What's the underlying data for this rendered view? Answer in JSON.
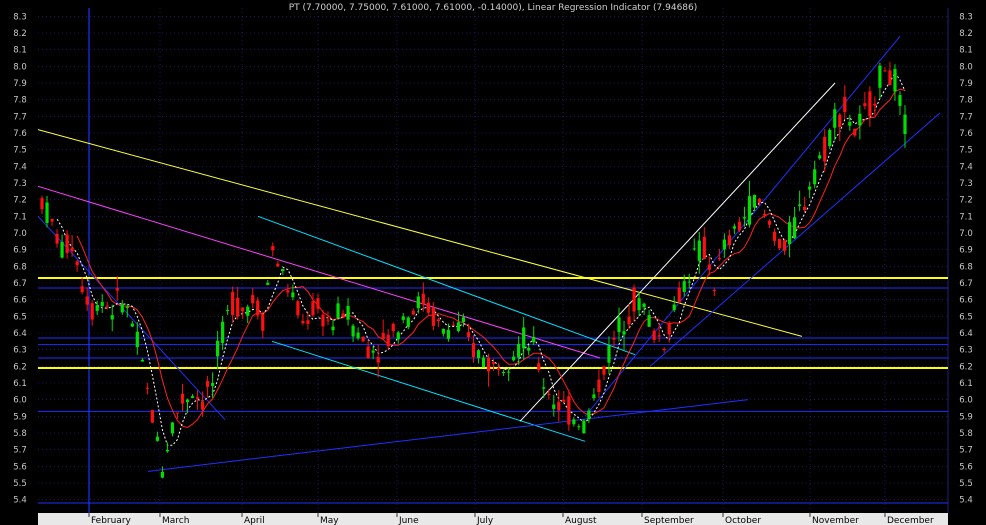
{
  "chart_data": {
    "type": "candlestick",
    "title": "PT (7.70000, 7.75000, 7.61000, 7.61000, -0.14000), Linear Regression Indicator (7.94686)",
    "y_ticks": [
      "5.4",
      "5.5",
      "5.6",
      "5.7",
      "5.8",
      "5.9",
      "6.0",
      "6.1",
      "6.2",
      "6.3",
      "6.4",
      "6.5",
      "6.6",
      "6.7",
      "6.8",
      "6.9",
      "7.0",
      "7.1",
      "7.2",
      "7.3",
      "7.4",
      "7.5",
      "7.6",
      "7.7",
      "7.8",
      "7.9",
      "8.0",
      "8.1",
      "8.2",
      "8.3"
    ],
    "ylim": [
      5.35,
      8.35
    ],
    "x_month_labels": [
      "February",
      "March",
      "April",
      "May",
      "June",
      "July",
      "August",
      "September",
      "October",
      "November",
      "December"
    ],
    "grid": "dotted",
    "series": [
      {
        "name": "PT",
        "type": "candlestick",
        "last": {
          "open": 7.7,
          "high": 7.75,
          "low": 7.61,
          "close": 7.61,
          "change": -0.14
        }
      },
      {
        "name": "Linear Regression Indicator",
        "value": 7.94686
      }
    ],
    "price_path": [
      [
        0,
        7.2
      ],
      [
        2,
        7.05
      ],
      [
        4,
        6.9
      ],
      [
        6,
        6.95
      ],
      [
        8,
        6.7
      ],
      [
        10,
        6.55
      ],
      [
        12,
        6.6
      ],
      [
        14,
        6.55
      ],
      [
        16,
        6.6
      ],
      [
        18,
        6.45
      ],
      [
        20,
        6.2
      ],
      [
        22,
        5.9
      ],
      [
        24,
        5.6
      ],
      [
        26,
        5.85
      ],
      [
        28,
        6.0
      ],
      [
        30,
        6.05
      ],
      [
        32,
        6.0
      ],
      [
        34,
        6.1
      ],
      [
        36,
        6.4
      ],
      [
        38,
        6.6
      ],
      [
        40,
        6.55
      ],
      [
        42,
        6.6
      ],
      [
        44,
        6.5
      ],
      [
        46,
        6.9
      ],
      [
        48,
        6.75
      ],
      [
        50,
        6.6
      ],
      [
        52,
        6.45
      ],
      [
        54,
        6.55
      ],
      [
        56,
        6.5
      ],
      [
        58,
        6.45
      ],
      [
        60,
        6.55
      ],
      [
        62,
        6.45
      ],
      [
        64,
        6.35
      ],
      [
        66,
        6.3
      ],
      [
        68,
        6.35
      ],
      [
        70,
        6.4
      ],
      [
        72,
        6.5
      ],
      [
        74,
        6.55
      ],
      [
        76,
        6.6
      ],
      [
        78,
        6.5
      ],
      [
        80,
        6.4
      ],
      [
        82,
        6.45
      ],
      [
        84,
        6.4
      ],
      [
        86,
        6.3
      ],
      [
        88,
        6.25
      ],
      [
        90,
        6.2
      ],
      [
        92,
        6.25
      ],
      [
        94,
        6.3
      ],
      [
        96,
        6.35
      ],
      [
        98,
        6.3
      ],
      [
        100,
        6.1
      ],
      [
        102,
        6.0
      ],
      [
        104,
        5.95
      ],
      [
        106,
        5.9
      ],
      [
        108,
        5.85
      ],
      [
        110,
        6.0
      ],
      [
        112,
        6.2
      ],
      [
        114,
        6.35
      ],
      [
        116,
        6.5
      ],
      [
        118,
        6.6
      ],
      [
        120,
        6.55
      ],
      [
        122,
        6.4
      ],
      [
        124,
        6.35
      ],
      [
        126,
        6.55
      ],
      [
        128,
        6.7
      ],
      [
        130,
        6.85
      ],
      [
        132,
        6.9
      ],
      [
        134,
        6.7
      ],
      [
        136,
        6.9
      ],
      [
        138,
        7.0
      ],
      [
        140,
        7.1
      ],
      [
        142,
        7.2
      ],
      [
        144,
        7.1
      ],
      [
        146,
        7.0
      ],
      [
        148,
        6.9
      ],
      [
        150,
        7.05
      ],
      [
        152,
        7.2
      ],
      [
        154,
        7.4
      ],
      [
        156,
        7.5
      ],
      [
        158,
        7.7
      ],
      [
        160,
        7.75
      ],
      [
        162,
        7.6
      ],
      [
        164,
        7.7
      ],
      [
        166,
        7.85
      ],
      [
        168,
        8.0
      ],
      [
        170,
        7.9
      ],
      [
        172,
        7.61
      ]
    ]
  },
  "horizontal_lines": [
    {
      "value": 6.73,
      "color": "#ffff00",
      "width": 2
    },
    {
      "value": 6.19,
      "color": "#ffff00",
      "width": 2
    },
    {
      "value": 6.67,
      "color": "#2030ff",
      "width": 1
    },
    {
      "value": 6.37,
      "color": "#2030ff",
      "width": 1
    },
    {
      "value": 6.33,
      "color": "#2030ff",
      "width": 1
    },
    {
      "value": 6.25,
      "color": "#2030ff",
      "width": 1
    },
    {
      "value": 5.93,
      "color": "#2030ff",
      "width": 1
    },
    {
      "value": 5.38,
      "color": "#2030ff",
      "width": 1
    }
  ],
  "colors": {
    "background": "#000000",
    "up_candle": "#00e000",
    "down_candle": "#ff1010",
    "grid": "#2a2aa0",
    "axis_strip": "#e8e8e8"
  }
}
